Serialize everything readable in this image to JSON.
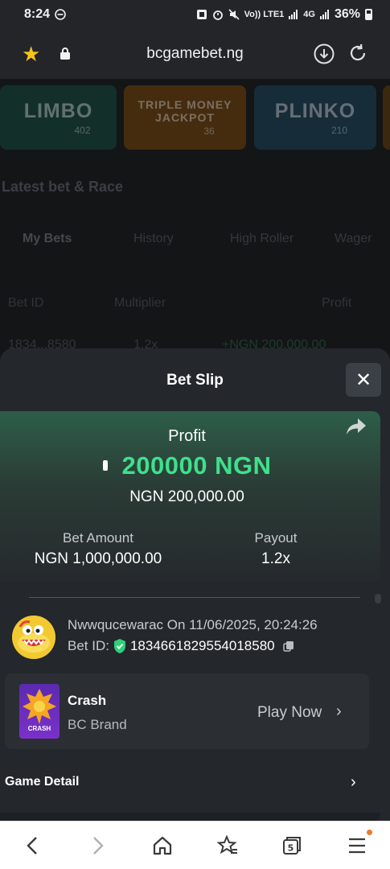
{
  "status_bar": {
    "time": "8:24",
    "network_labels": [
      "Vo)) LTE1",
      "4G"
    ],
    "battery": "36%"
  },
  "browser": {
    "url": "bcgamebet.ng"
  },
  "background_page": {
    "tiles": [
      {
        "title": "LIMBO",
        "count": "402"
      },
      {
        "title": "TRIPLE MONEY JACKPOT",
        "count": "36"
      },
      {
        "title": "PLINKO",
        "count": "210"
      }
    ],
    "section_heading": "Latest bet & Race",
    "tabs": [
      "My Bets",
      "History",
      "High Roller",
      "Wager"
    ],
    "table_headers": [
      "Bet ID",
      "Multiplier",
      "Profit"
    ],
    "row": {
      "bet_id": "1834...8580",
      "multiplier": "1.2x",
      "profit": "+NGN 200,000.00"
    }
  },
  "bet_slip": {
    "title": "Bet Slip",
    "profit_label": "Profit",
    "profit_amount": "200000 NGN",
    "profit_sub": "NGN 200,000.00",
    "bet_amount_label": "Bet Amount",
    "bet_amount_value": "NGN 1,000,000.00",
    "payout_label": "Payout",
    "payout_value": "1.2x",
    "user_line": "Nwwqucewarac On 11/06/2025, 20:24:26",
    "bet_id_label": "Bet ID:",
    "bet_id_value": "1834661829554018580",
    "game": {
      "name": "Crash",
      "brand": "BC Brand",
      "thumb_label": "CRASH",
      "play_label": "Play Now"
    },
    "game_detail_label": "Game Detail"
  },
  "colors": {
    "profit_green": "#3fe08b",
    "star_yellow": "#f5c518"
  }
}
